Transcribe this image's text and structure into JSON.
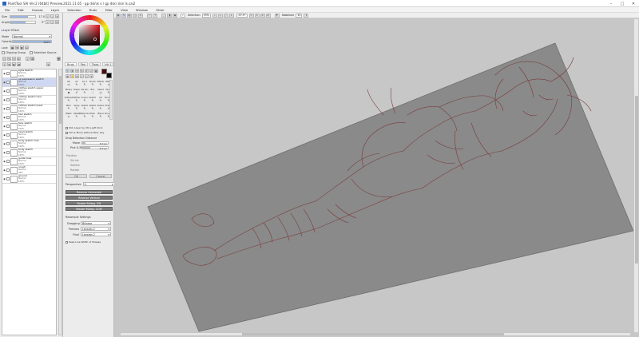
{
  "window": {
    "title": "PaintTool SAI Ver.2 (64bit) Preview.2021.11.05 - gp dsk\\ls v / gp dsk\\ skin ls.sai2",
    "minimize": "–",
    "maximize": "□",
    "close": "✕"
  },
  "menu": [
    "File",
    "Edit",
    "Canvas",
    "Layer",
    "Selection",
    "Ruler",
    "Filter",
    "View",
    "Window",
    "Other"
  ],
  "brush": {
    "size_label": "Size",
    "size_value": "17.0",
    "angle_label": "Angle",
    "angle_value": "0°",
    "size_fill": 0.7,
    "angle_fill": 0.62
  },
  "layer_props": {
    "layer_effect": "Layer Effect",
    "mode_label": "Mode",
    "mode_value": "Normal",
    "opacity_label": "Opacity",
    "opacity_value": "100%",
    "lock_label": "Lock",
    "clipping_label": "Clipping Group",
    "selection_label": "Selection Source"
  },
  "layers": [
    {
      "name": "eyes sketch",
      "mode": "Normal",
      "opacity": "100%",
      "selected": false
    },
    {
      "name": "up expression sketch",
      "mode": "Normal",
      "opacity": "100%",
      "selected": true
    },
    {
      "name": "clothes sketch upper",
      "mode": "Normal",
      "opacity": "100%",
      "selected": false
    },
    {
      "name": "clothes sketch misc",
      "mode": "Normal",
      "opacity": "100%",
      "selected": false
    },
    {
      "name": "clothes sketch lower",
      "mode": "Normal",
      "opacity": "100%",
      "selected": false
    },
    {
      "name": "hair sketch",
      "mode": "Normal",
      "opacity": "100%",
      "selected": false
    },
    {
      "name": "face sketch",
      "mode": "Normal",
      "opacity": "100%",
      "selected": false
    },
    {
      "name": "head sketch",
      "mode": "Normal",
      "opacity": "100%",
      "selected": false
    },
    {
      "name": "body sketch misc",
      "mode": "Normal",
      "opacity": "100%",
      "selected": false
    },
    {
      "name": "body sketch",
      "mode": "Normal",
      "opacity": "100%",
      "selected": false
    },
    {
      "name": "guide lines",
      "mode": "Normal",
      "opacity": "100%",
      "selected": false
    },
    {
      "name": "rough",
      "mode": "Normal",
      "opacity": "40%",
      "selected": false
    },
    {
      "name": "ground",
      "mode": "Normal",
      "opacity": "100%",
      "selected": false
    }
  ],
  "tool_tabs": [
    "Brush",
    "Pen",
    "Trans",
    "Ink 1",
    "Ruler"
  ],
  "tools": [
    {
      "label": "Sel",
      "icon": "▭"
    },
    {
      "label": "Air",
      "icon": "✎"
    },
    {
      "label": "Ink 1",
      "icon": "✎"
    },
    {
      "label": "Brush",
      "icon": "✎"
    },
    {
      "label": "Marker",
      "icon": "✎"
    },
    {
      "label": "Water",
      "icon": "≈"
    },
    {
      "label": "Binary",
      "icon": "▪"
    },
    {
      "label": "Eraser",
      "icon": "✐"
    },
    {
      "label": "Sel Pen",
      "icon": "✎"
    },
    {
      "label": "Blur",
      "icon": "◌"
    },
    {
      "label": "Select",
      "icon": "◎"
    },
    {
      "label": "Pencil",
      "icon": "✎"
    },
    {
      "label": "AirBrush",
      "icon": "✎"
    },
    {
      "label": "Marker",
      "icon": "✎"
    },
    {
      "label": "Crayon",
      "icon": "✎"
    },
    {
      "label": "Sketch",
      "icon": "✎"
    },
    {
      "label": "Ink",
      "icon": "✎"
    },
    {
      "label": "Smudge",
      "icon": "✎"
    },
    {
      "label": "Marc",
      "icon": "✎"
    },
    {
      "label": "Spray",
      "icon": "✎"
    },
    {
      "label": "Sketch",
      "icon": "✎"
    },
    {
      "label": "Sketch",
      "icon": "✎"
    },
    {
      "label": "Outline",
      "icon": "✎"
    },
    {
      "label": "Eraser",
      "icon": "✐"
    },
    {
      "label": "Water",
      "icon": "≈"
    },
    {
      "label": "Pastel",
      "icon": "✎"
    },
    {
      "label": "Watercolor",
      "icon": "✎"
    },
    {
      "label": "Dark",
      "icon": "✎"
    },
    {
      "label": "Blend",
      "icon": "✎"
    },
    {
      "label": "Smudge",
      "icon": "✎"
    }
  ],
  "tool_options": {
    "pick_layer": "Pick Layer by Ctrl+Left Click",
    "ctrl_move": "Ctrl & Move without Mod. Key",
    "drag_title": "Drag Detection Distance",
    "move_label": "Move",
    "move_value": "4.0 px",
    "pick_move_label": "Pick & Move",
    "pick_move_value": "4.0 px",
    "pos_opts": [
      "Position",
      "Shrink",
      "Sattern",
      "Rotate"
    ],
    "ok": "OK",
    "cancel": "Cancel",
    "perspective_label": "Perspective",
    "perspective_value": "0",
    "reverse_h": "Reverse Horizontal",
    "reverse_v": "Reverse Vertical",
    "rotate_cw": "Rotate 90deg. CW",
    "rotate_ccw": "Rotate 90deg. CCW",
    "resample_title": "Resample Settings",
    "dragging_label": "Dragging",
    "dragging_value": "Bilinear",
    "preview_label": "Preview",
    "preview_value": "Lanczos 2",
    "final_label": "Final",
    "final_value": "Lanczos 2",
    "keep_line": "Keep Line Width of Shapes"
  },
  "canvas_toolbar": {
    "selection_label": "Selection",
    "zoom_value": "33%",
    "angle_value": "-57.9°",
    "stabilizer_label": "Stabilizer",
    "stabilizer_value": "10"
  },
  "colors": {
    "accent": "#9db6e0",
    "selected_layer": "#cfd8f2",
    "canvas_paper": "#8a8a8a",
    "sketch_line": "#7a3b3b"
  }
}
